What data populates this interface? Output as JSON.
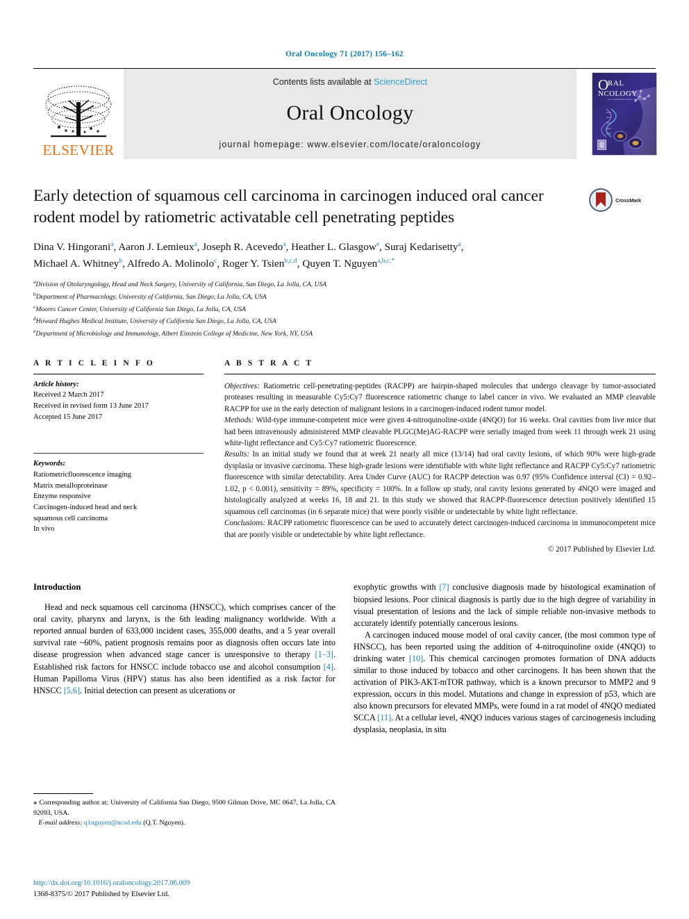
{
  "running_head": "Oral Oncology 71 (2017) 156–162",
  "masthead": {
    "publisher_name": "ELSEVIER",
    "contents_prefix": "Contents lists available at ",
    "contents_link": "ScienceDirect",
    "journal_title": "Oral Oncology",
    "homepage": "journal homepage: www.elsevier.com/locate/oraloncology",
    "cover_title_line1": "RAL",
    "cover_title_line2": "NCOLOGY",
    "cover_subtitle": "AN INTERNATIONAL JOURNAL"
  },
  "article": {
    "title": "Early detection of squamous cell carcinoma in carcinogen induced oral cancer rodent model by ratiometric activatable cell penetrating peptides",
    "crossmark_label": "CrossMark",
    "authors_line1": "Dina V. Hingorani a, Aaron J. Lemieux a, Joseph R. Acevedo a, Heather L. Glasgow e, Suraj Kedarisetty a,",
    "authors_line2": "Michael A. Whitney b, Alfredo A. Molinolo c, Roger Y. Tsien b,c,d, Quyen T. Nguyen a,b,c,*",
    "authors": [
      {
        "name": "Dina V. Hingorani",
        "sup": "a",
        "sep": ", "
      },
      {
        "name": "Aaron J. Lemieux",
        "sup": "a",
        "sep": ", "
      },
      {
        "name": "Joseph R. Acevedo",
        "sup": "a",
        "sep": ", "
      },
      {
        "name": "Heather L. Glasgow",
        "sup": "e",
        "sep": ", "
      },
      {
        "name": "Suraj Kedarisetty",
        "sup": "a",
        "sep": ","
      },
      {
        "name": "Michael A. Whitney",
        "sup": "b",
        "sep": ", "
      },
      {
        "name": "Alfredo A. Molinolo",
        "sup": "c",
        "sep": ", "
      },
      {
        "name": "Roger Y. Tsien",
        "sup": "b,c,d",
        "sep": ", "
      },
      {
        "name": "Quyen T. Nguyen",
        "sup": "a,b,c,*",
        "sep": ""
      }
    ],
    "affiliations": [
      {
        "marker": "a",
        "text": "Division of Otolaryngology, Head and Neck Surgery, University of California, San Diego, La Jolla, CA, USA"
      },
      {
        "marker": "b",
        "text": "Department of Pharmacology, University of California, San Diego, La Jolla, CA, USA"
      },
      {
        "marker": "c",
        "text": "Moores Cancer Center, University of California San Diego, La Jolla, CA, USA"
      },
      {
        "marker": "d",
        "text": "Howard Hughes Medical Institute, University of California San Diego, La Jolla, CA, USA"
      },
      {
        "marker": "e",
        "text": "Department of Microbiology and Immunology, Albert Einstein College of Medicine, New York, NY, USA"
      }
    ]
  },
  "article_info": {
    "heading": "A R T I C L E   I N F O",
    "history_label": "Article history:",
    "history": [
      "Received 2 March 2017",
      "Received in revised form 13 June 2017",
      "Accepted 15 June 2017"
    ],
    "keywords_label": "Keywords:",
    "keywords": [
      "Ratiometricfluorescence imaging",
      "Matrix metalloproteinase",
      "Enzyme responsive",
      "Carcinogen-induced head and neck",
      "squamous cell carcinoma",
      "In vivo"
    ]
  },
  "abstract": {
    "heading": "A B S T R A C T",
    "sections": [
      {
        "label": "Objectives:",
        "text": " Ratiometric cell-penetrating-peptides (RACPP) are hairpin-shaped molecules that undergo cleavage by tumor-associated proteases resulting in measurable Cy5:Cy7 fluorescence ratiometric change to label cancer in vivo. We evaluated an MMP cleavable RACPP for use in the early detection of malignant lesions in a carcinogen-induced rodent tumor model."
      },
      {
        "label": "Methods:",
        "text": " Wild-type immune-competent mice were given 4-nitroquinoline-oxide (4NQO) for 16 weeks. Oral cavities from live mice that had been intravenously administered MMP cleavable PLGC(Me)AG-RACPP were serially imaged from week 11 through week 21 using white-light reflectance and Cy5:Cy7 ratiometric fluorescence."
      },
      {
        "label": "Results:",
        "text": " In an initial study we found that at week 21 nearly all mice (13/14) had oral cavity lesions, of which 90% were high-grade dysplasia or invasive carcinoma. These high-grade lesions were identifiable with white light reflectance and RACPP Cy5:Cy7 ratiometric fluorescence with similar detectability. Area Under Curve (AUC) for RACPP detection was 0.97 (95% Confidence interval (CI) = 0.92–1.02, p < 0.001), sensitivity = 89%, specificity = 100%. In a follow up study, oral cavity lesions generated by 4NQO were imaged and histologically analyzed at weeks 16, 18 and 21. In this study we showed that RACPP-fluorescence detection positively identified 15 squamous cell carcinomas (in 6 separate mice) that were poorly visible or undetectable by white light reflectance."
      },
      {
        "label": "Conclusions:",
        "text": " RACPP ratiometric fluorescence can be used to accurately detect carcinogen-induced carcinoma in immunocompetent mice that are poorly visible or undetectable by white light reflectance."
      }
    ],
    "copyright": "© 2017 Published by Elsevier Ltd."
  },
  "body": {
    "section_title": "Introduction",
    "left_paragraphs": [
      {
        "parts": [
          {
            "t": "Head and neck squamous cell carcinoma (HNSCC), which comprises cancer of the oral cavity, pharynx and larynx, is the 6th leading malignancy worldwide. With a reported annual burden of 633,000 incident cases, 355,000 deaths, and a 5 year overall survival rate ~60%, patient prognosis remains poor as diagnosis often occurs late into disease progression when advanced stage cancer is unresponsive to therapy ",
            "ref": false
          },
          {
            "t": "[1–3]",
            "ref": true
          },
          {
            "t": ". Established risk factors for HNSCC include tobacco use and alcohol consumption ",
            "ref": false
          },
          {
            "t": "[4]",
            "ref": true
          },
          {
            "t": ". Human Papilloma Virus (HPV) status has also been identified as a risk factor for HNSCC ",
            "ref": false
          },
          {
            "t": "[5,6]",
            "ref": true
          },
          {
            "t": ". Initial detection can present as ulcerations or",
            "ref": false
          }
        ]
      }
    ],
    "right_paragraphs": [
      {
        "indent": false,
        "parts": [
          {
            "t": "exophytic growths with ",
            "ref": false
          },
          {
            "t": "[7]",
            "ref": true
          },
          {
            "t": " conclusive diagnosis made by histological examination of biopsied lesions. Poor clinical diagnosis is partly due to the high degree of variability in visual presentation of lesions and the lack of simple reliable non-invasive methods to accurately identify potentially cancerous lesions.",
            "ref": false
          }
        ]
      },
      {
        "indent": true,
        "parts": [
          {
            "t": "A carcinogen induced mouse model of oral cavity cancer, (the most common type of HNSCC), has been reported using the addition of 4-nitroquinoline oxide (4NQO) to drinking water ",
            "ref": false
          },
          {
            "t": "[10]",
            "ref": true
          },
          {
            "t": ". This chemical carcinogen promotes formation of DNA adducts similar to those induced by tobacco and other carcinogens. It has been shown that the activation of PIK3-AKT-mTOR pathway, which is a known precursor to MMP2 and 9 expression, occurs in this model. Mutations and change in expression of p53, which are also known precursors for elevated MMPs, were found in a rat model of 4NQO mediated SCCA ",
            "ref": false
          },
          {
            "t": "[11]",
            "ref": true
          },
          {
            "t": ". At a cellular level, 4NQO induces various stages of carcinogenesis including dysplasia, neoplasia, in situ",
            "ref": false
          }
        ]
      }
    ]
  },
  "footnote": {
    "star": "⁎",
    "corresponding": " Corresponding author at: University of California San Diego, 9500 Gilman Drive, MC 0647, La Jolla, CA 92093, USA.",
    "email_label": "E-mail address:",
    "email": "q1nguyen@ucsd.edu",
    "email_attrib": " (Q.T. Nguyen)."
  },
  "page_footer": {
    "doi": "http://dx.doi.org/10.1016/j.oraloncology.2017.06.009",
    "issn_line": "1368-8375/© 2017 Published by Elsevier Ltd."
  },
  "colors": {
    "link": "#1a7fb5",
    "running_head": "#0b7ab5",
    "elsevier_orange": "#f06f12",
    "sciencedirect": "#2f9fd0"
  }
}
